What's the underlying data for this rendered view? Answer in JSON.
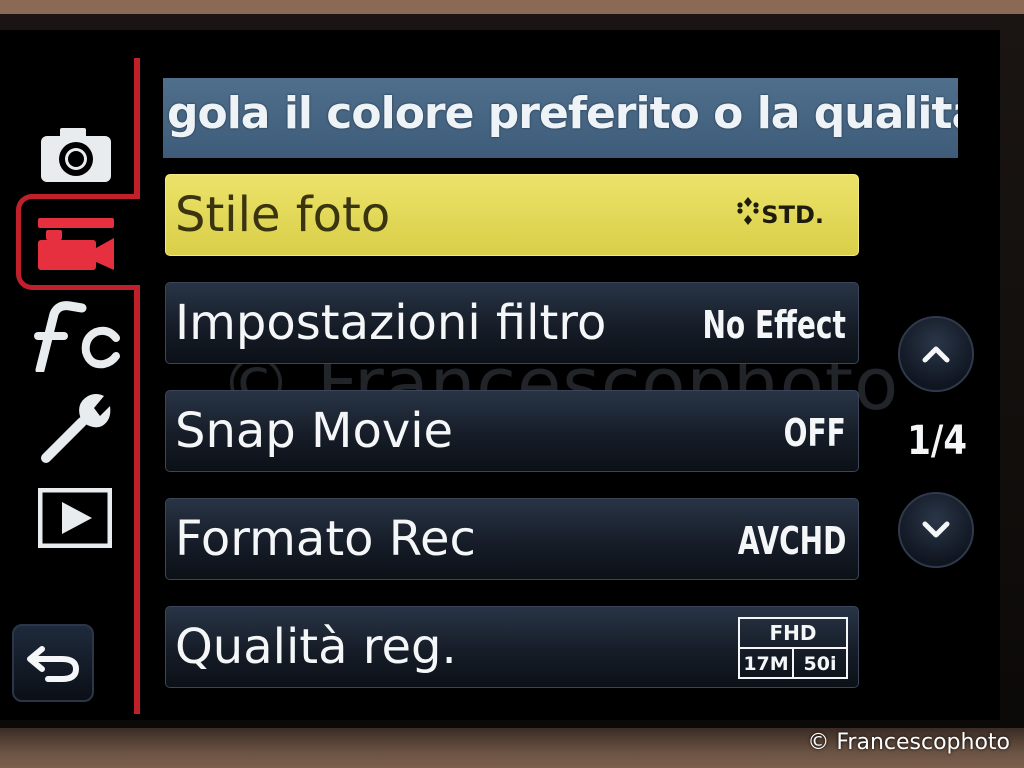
{
  "banner": {
    "text": "gola il colore preferito o la qualità"
  },
  "side_tabs": [
    {
      "icon": "camera-icon",
      "label": ""
    },
    {
      "icon": "movie-camera-icon",
      "label": ""
    },
    {
      "icon": "custom-fc-icon",
      "label": ""
    },
    {
      "icon": "wrench-icon",
      "label": ""
    },
    {
      "icon": "playback-icon",
      "label": ""
    }
  ],
  "menu": {
    "items": [
      {
        "label": "Stile foto",
        "value_icon": "std-photo-style-icon",
        "value_text": "STD."
      },
      {
        "label": "Impostazioni filtro",
        "value": "No Effect"
      },
      {
        "label": "Snap Movie",
        "value": "OFF"
      },
      {
        "label": "Formato Rec",
        "value": "AVCHD"
      },
      {
        "label": "Qualità reg.",
        "quality": {
          "top": "FHD",
          "left": "17M",
          "right": "50i"
        }
      }
    ]
  },
  "pagination": {
    "current": "1/4"
  },
  "watermark": "© Francescophoto",
  "credit": "© Francescophoto",
  "colors": {
    "accent_red": "#c0202a",
    "selected_row": "#e4da58",
    "banner_bg": "#4a6a88"
  }
}
